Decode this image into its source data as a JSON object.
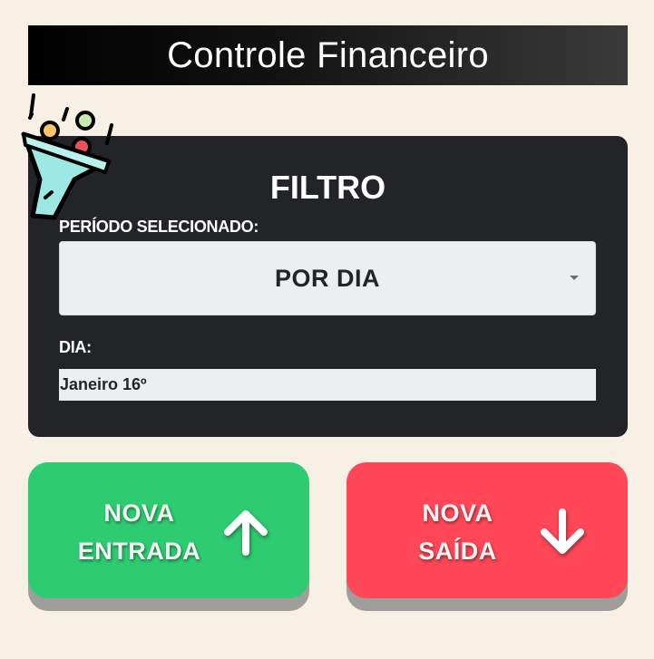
{
  "header": {
    "title": "Controle Financeiro"
  },
  "filter": {
    "title": "FILTRO",
    "period_label": "PERÍODO SELECIONADO:",
    "period_value": "POR DIA",
    "day_label": "DIA:",
    "day_value": "Janeiro 16º",
    "icon": "funnel-icon"
  },
  "actions": {
    "income": {
      "line1": "NOVA",
      "line2": "ENTRADA",
      "icon": "arrow-up-icon",
      "color": "#2ecc71"
    },
    "expense": {
      "line1": "NOVA",
      "line2": "SAÍDA",
      "icon": "arrow-down-icon",
      "color": "#ff4757"
    }
  },
  "colors": {
    "background": "#f7f0e4",
    "card": "#232427",
    "green": "#2ecc71",
    "red": "#ff4757"
  }
}
